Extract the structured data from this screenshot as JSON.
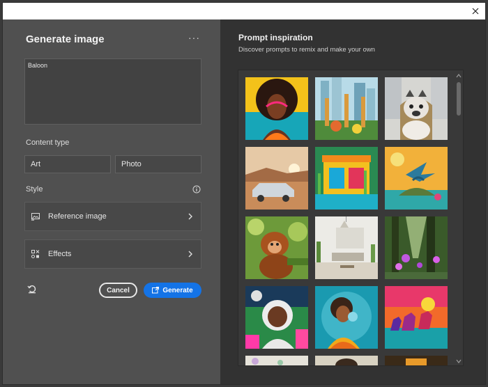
{
  "generate_panel": {
    "title": "Generate image",
    "more_label": "···",
    "prompt_value": "Baloon",
    "content_type_label": "Content type",
    "content_types": [
      "Art",
      "Photo"
    ],
    "style_label": "Style",
    "reference_image_label": "Reference image",
    "effects_label": "Effects",
    "cancel_label": "Cancel",
    "generate_label": "Generate"
  },
  "inspiration": {
    "title": "Prompt inspiration",
    "subtitle": "Discover prompts to remix and make your own",
    "thumbnails": [
      {
        "name": "afro-portrait"
      },
      {
        "name": "giraffes-city"
      },
      {
        "name": "bulldog-throne"
      },
      {
        "name": "vintage-car-desert"
      },
      {
        "name": "colorful-house"
      },
      {
        "name": "dragon-island"
      },
      {
        "name": "orangutan-jungle"
      },
      {
        "name": "minimal-living-room"
      },
      {
        "name": "fairy-forest"
      },
      {
        "name": "astronaut-neon"
      },
      {
        "name": "bubblegum-girl"
      },
      {
        "name": "neon-horses"
      }
    ]
  },
  "colors": {
    "accent": "#1473e6",
    "panel_left": "#505050",
    "panel_right": "#323232"
  },
  "icons": {
    "close": "close-icon",
    "info": "info-icon",
    "reference": "image-icon",
    "effects": "effects-icon",
    "reset": "reset-icon",
    "generate": "generate-icon"
  }
}
